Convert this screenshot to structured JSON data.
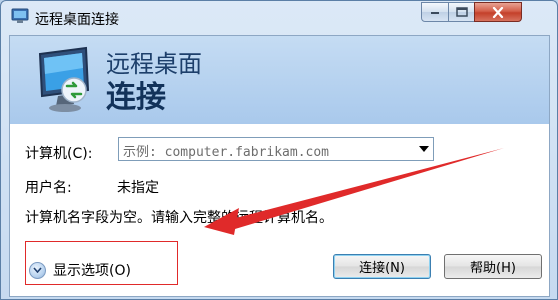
{
  "window": {
    "title": "远程桌面连接",
    "buttons": {
      "minimize": "minimize-icon",
      "maximize": "maximize-icon",
      "close": "close-icon"
    }
  },
  "header": {
    "line1": "远程桌面",
    "line2": "连接",
    "icon": "remote-desktop-monitor-icon"
  },
  "form": {
    "computer_label": "计算机(C):",
    "computer_placeholder": "示例: computer.fabrikam.com",
    "user_label": "用户名:",
    "user_value": "未指定",
    "message": "计算机名字段为空。请输入完整的远程计算机名。"
  },
  "footer": {
    "show_options": "显示选项(O)",
    "connect_button": "连接(N)",
    "help_button": "帮助(H)"
  },
  "annotation": {
    "color": "#e02a2a",
    "arrow": "red-arrow-pointing-to-message"
  }
}
